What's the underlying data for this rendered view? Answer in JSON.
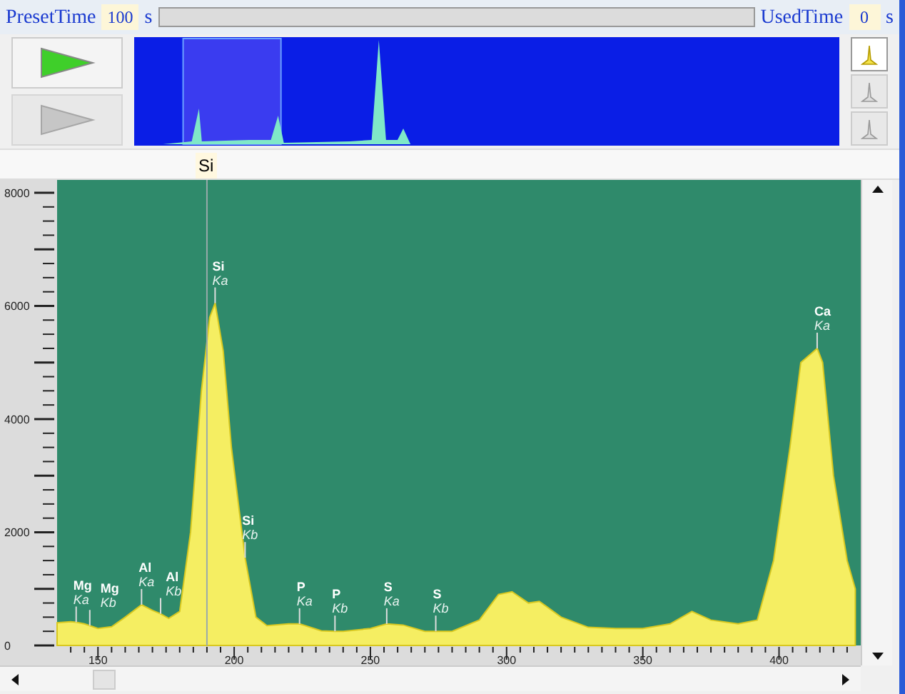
{
  "acquisition_bar": {
    "preset_label": "PresetTime",
    "preset_value": "100",
    "preset_unit": "s",
    "progress": {
      "level": 0
    },
    "used_label": "UsedTime",
    "used_value": "0",
    "used_unit": "s"
  },
  "controls": [
    {
      "kind": "start",
      "disabled": false
    },
    {
      "kind": "step",
      "disabled": true
    }
  ],
  "view_buttons": [
    {
      "selected": true
    },
    {
      "selected": false
    },
    {
      "selected": false
    }
  ],
  "cursor": {
    "label": "Si"
  },
  "chart_data": {
    "type": "area",
    "xlim": [
      135,
      430
    ],
    "ylim": [
      0,
      8227
    ],
    "xticks": [
      150,
      200,
      250,
      300,
      350,
      400
    ],
    "yticks": [
      0,
      2000,
      4000,
      6000,
      8000
    ],
    "x": [
      135,
      140,
      142,
      145,
      147,
      150,
      155,
      160,
      166,
      170,
      173,
      176,
      180,
      184,
      188,
      191,
      193,
      196,
      199,
      204,
      208,
      212,
      220,
      224,
      232,
      237,
      240,
      250,
      256,
      262,
      270,
      274,
      280,
      290,
      297,
      302,
      308,
      312,
      320,
      330,
      340,
      350,
      360,
      368,
      375,
      385,
      392,
      398,
      404,
      408,
      414,
      416,
      420,
      425,
      428
    ],
    "series": [
      {
        "color": "#f5ee62",
        "values": [
          400,
          420,
          410,
          380,
          350,
          300,
          330,
          500,
          720,
          620,
          560,
          480,
          600,
          2000,
          4500,
          5800,
          6050,
          5200,
          3500,
          1550,
          500,
          350,
          380,
          380,
          260,
          250,
          250,
          300,
          380,
          360,
          250,
          250,
          250,
          450,
          900,
          950,
          750,
          780,
          500,
          320,
          300,
          300,
          380,
          600,
          450,
          380,
          450,
          1500,
          3500,
          5000,
          5250,
          5000,
          3000,
          1500,
          1000
        ]
      }
    ],
    "ref_lines": [
      {
        "axis": "x",
        "value": 190
      }
    ],
    "annotations": [
      {
        "x": 142,
        "y": 410,
        "text": "Mg Ka"
      },
      {
        "x": 147,
        "y": 350,
        "text": "Mg Kb"
      },
      {
        "x": 166,
        "y": 720,
        "text": "Al Ka"
      },
      {
        "x": 173,
        "y": 560,
        "text": "Al Kb"
      },
      {
        "x": 193,
        "y": 6050,
        "text": "Si Ka"
      },
      {
        "x": 204,
        "y": 1550,
        "text": "Si Kb"
      },
      {
        "x": 224,
        "y": 380,
        "text": "P Ka"
      },
      {
        "x": 237,
        "y": 250,
        "text": "P Kb"
      },
      {
        "x": 256,
        "y": 380,
        "text": "S Ka"
      },
      {
        "x": 274,
        "y": 250,
        "text": "S Kb"
      },
      {
        "x": 414,
        "y": 5250,
        "text": "Ca Ka"
      }
    ]
  }
}
